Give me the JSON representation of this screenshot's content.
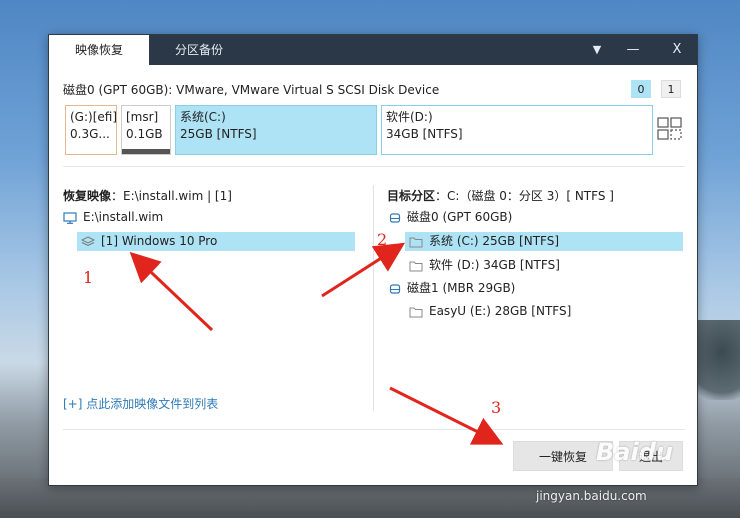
{
  "tabs": [
    {
      "label": "映像恢复",
      "active": true
    },
    {
      "label": "分区备份",
      "active": false
    }
  ],
  "titlebar": {
    "menu_glyph": "▼",
    "minimize_glyph": "—",
    "close_glyph": "X"
  },
  "disk_bar": {
    "title": "磁盘0 (GPT 60GB): VMware, VMware Virtual S SCSI Disk Device",
    "disk_buttons": [
      "0",
      "1"
    ],
    "partitions": [
      {
        "name": "(G:)[efi]",
        "size": "0.3G..."
      },
      {
        "name": "[msr]",
        "size": "0.1GB"
      },
      {
        "name": "系统(C:)",
        "size": "25GB [NTFS]"
      },
      {
        "name": "软件(D:)",
        "size": "34GB [NTFS]"
      }
    ]
  },
  "left_panel": {
    "label": "恢复映像",
    "value": "：E:\\install.wim | [1]",
    "tree": [
      {
        "text": "E:\\install.wim",
        "icon": "monitor-icon"
      },
      {
        "text": "[1] Windows 10 Pro",
        "icon": "layers-icon",
        "selected": true
      }
    ],
    "add_link": "[+] 点此添加映像文件到列表"
  },
  "right_panel": {
    "label": "目标分区",
    "value": "：C:（磁盘 0：分区 3）[ NTFS ]",
    "tree": [
      {
        "text": "磁盘0 (GPT 60GB)",
        "icon": "disk-icon"
      },
      {
        "text": "系统 (C:) 25GB [NTFS]",
        "icon": "folder-icon",
        "selected": true
      },
      {
        "text": "软件 (D:) 34GB [NTFS]",
        "icon": "folder-icon"
      },
      {
        "text": "磁盘1 (MBR 29GB)",
        "icon": "disk-icon"
      },
      {
        "text": "EasyU (E:) 28GB [NTFS]",
        "icon": "folder-icon"
      }
    ]
  },
  "buttons": {
    "restore": "一键恢复",
    "exit": "退出"
  },
  "annotations": [
    "1",
    "2",
    "3"
  ],
  "watermark": {
    "logo": "Baidu",
    "url": "jingyan.baidu.com"
  },
  "colors": {
    "titlebar": "#2a3847",
    "selection": "#aee3f5",
    "arrow": "#e0261c",
    "link": "#2f7ab7"
  }
}
